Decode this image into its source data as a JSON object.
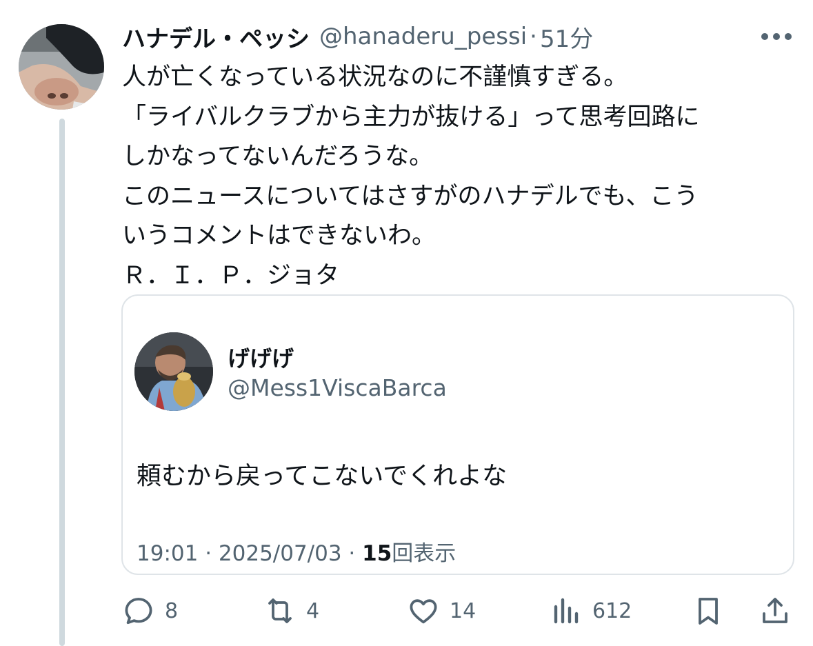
{
  "tweet": {
    "display_name": "ハナデル・ペッシ",
    "handle": "@hanaderu_pessi",
    "separator": "·",
    "time": "51分",
    "more_icon": "more-horizontal-icon",
    "body_lines": [
      "人が亡くなっている状況なのに不謹慎すぎる。",
      "「ライバルクラブから主力が抜ける」って思考回路に",
      "しかなってないんだろうな。",
      "このニュースについてはさすがのハナデルでも、こう",
      "いうコメントはできないわ。",
      "Ｒ．Ｉ．Ｐ．ジョタ"
    ]
  },
  "quote": {
    "display_name": "げげげ",
    "handle": "@Mess1ViscaBarca",
    "text": "頼むから戻ってこないでくれよな",
    "timestamp": "19:01 · 2025/07/03 ·",
    "views_count": "15",
    "views_label": "回表示"
  },
  "actions": {
    "reply": {
      "icon": "reply-icon",
      "count": "8"
    },
    "retweet": {
      "icon": "retweet-icon",
      "count": "4"
    },
    "like": {
      "icon": "heart-icon",
      "count": "14"
    },
    "views": {
      "icon": "views-bar-chart-icon",
      "count": "612"
    },
    "bookmark": {
      "icon": "bookmark-icon"
    },
    "share": {
      "icon": "share-icon"
    }
  },
  "colors": {
    "text_primary": "#0f1419",
    "text_secondary": "#536471",
    "border": "#dfe4e8",
    "thread_line": "#cfd9de"
  }
}
